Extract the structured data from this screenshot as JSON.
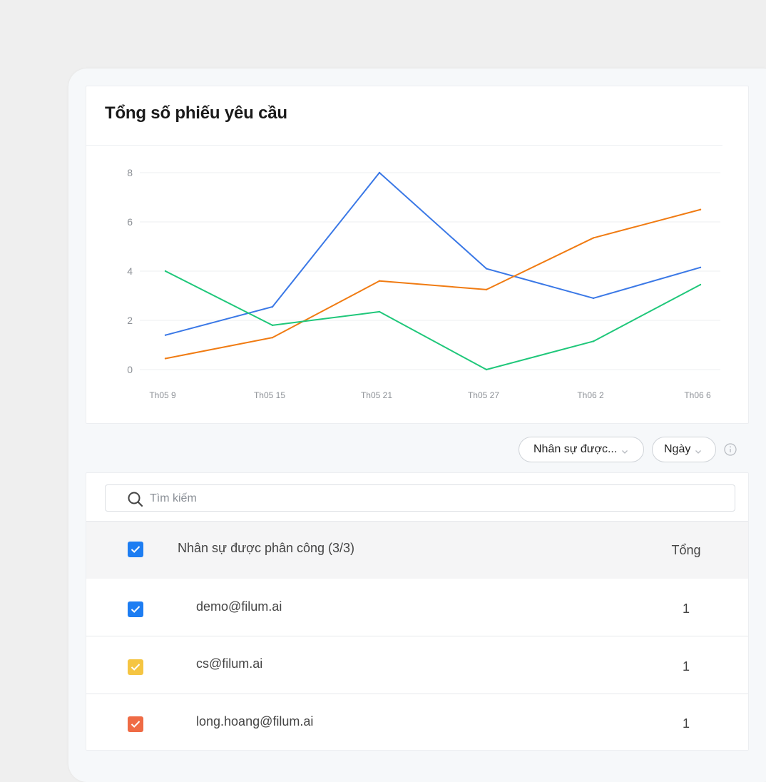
{
  "chart_data": {
    "type": "line",
    "title": "Tổng số phiếu yêu cầu",
    "x": [
      "Th05 9",
      "Th05 15",
      "Th05 21",
      "Th05 27",
      "Th06 2",
      "Th06 6"
    ],
    "ylim": [
      0,
      8
    ],
    "yticks": [
      0,
      2,
      4,
      6,
      8
    ],
    "grid": true,
    "series": [
      {
        "color": "#3a78e6",
        "values": [
          1.4,
          2.55,
          8.0,
          4.1,
          2.9,
          4.15
        ]
      },
      {
        "color": "#f07b12",
        "values": [
          0.45,
          1.3,
          3.6,
          3.25,
          5.35,
          6.5
        ]
      },
      {
        "color": "#1fc77a",
        "values": [
          4.0,
          1.8,
          2.35,
          0.0,
          1.15,
          3.45
        ]
      }
    ]
  },
  "filters": {
    "assignee_label": "Nhân sự được...",
    "period_label": "Ngày"
  },
  "search": {
    "placeholder": "Tìm kiếm"
  },
  "table": {
    "header_name": "Nhân sự được phân công (3/3)",
    "header_total": "Tổng",
    "header_checkbox_color": "#1d7df2",
    "rows": [
      {
        "email": "demo@filum.ai",
        "total": "1",
        "color": "#1d7df2"
      },
      {
        "email": "cs@filum.ai",
        "total": "1",
        "color": "#f5c542"
      },
      {
        "email": "long.hoang@filum.ai",
        "total": "1",
        "color": "#ef6b45"
      }
    ]
  }
}
